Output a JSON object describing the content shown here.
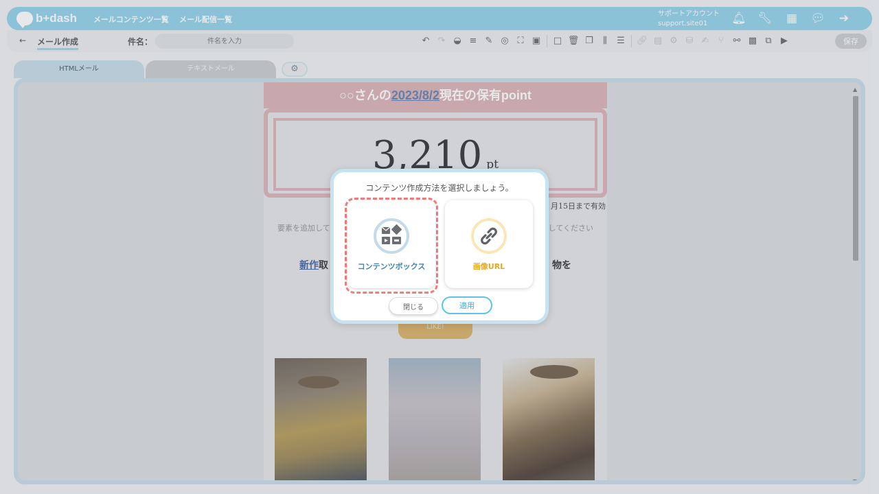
{
  "header": {
    "logo_text": "b+dash",
    "nav": [
      "メールコンテンツ一覧",
      "メール配信一覧"
    ],
    "account_label": "サポートアカウント",
    "account_id": "support.site01",
    "icons": [
      "bell-icon",
      "wrench-icon",
      "apps-grid-icon",
      "chat-icon",
      "logout-icon"
    ]
  },
  "toolbar": {
    "back_icon": "←",
    "page_title": "メール作成",
    "name_label": "件名：",
    "name_placeholder": "件名を入力",
    "save_label": "保存"
  },
  "tabs": {
    "html": "HTMLメール",
    "text": "テキストメール"
  },
  "mail": {
    "header_prefix": "○○さんの",
    "header_date": "2023/8/2",
    "header_suffix": "現在の保有point",
    "points": "3,210",
    "points_unit": "pt",
    "valid_until": "月15日まで有効",
    "hint_left": "要素を追加して",
    "hint_right": "してください",
    "body_link": "新作",
    "body_left": "取",
    "body_right": "物を",
    "like_button": "LIKE!"
  },
  "modal": {
    "title": "コンテンツ作成方法を選択しましょう。",
    "option_contentbox": "コンテンツボックス",
    "option_imageurl": "画像URL",
    "close_label": "閉じる",
    "apply_label": "適用"
  },
  "colors": {
    "brand": "#8fd1ea",
    "highlight_dash": "#f07e7e",
    "contentbox_text": "#3f86b8",
    "imageurl_text": "#e7a91f",
    "apply_border": "#5ec3e8"
  }
}
